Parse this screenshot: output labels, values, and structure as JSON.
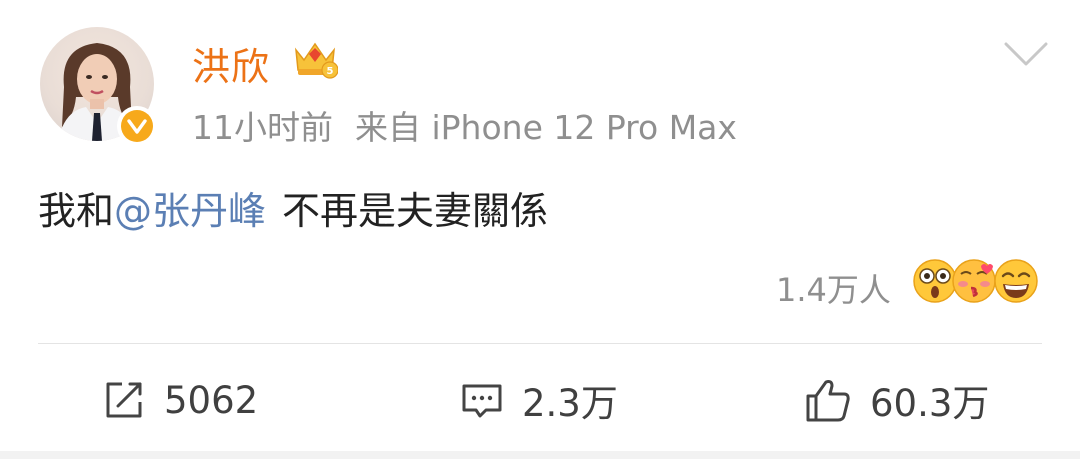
{
  "post": {
    "author": "洪欣",
    "time": "11小时前",
    "source": "来自 iPhone 12 Pro Max",
    "text_prefix": "我和",
    "mention": "@张丹峰",
    "text_suffix": "不再是夫妻關係"
  },
  "reactions": {
    "count_label": "1.4万人",
    "emoji_icons": [
      "shocked-emoji-icon",
      "kiss-emoji-icon",
      "laughing-emoji-icon"
    ]
  },
  "actions": {
    "repost": {
      "icon": "repost-icon",
      "count": "5062"
    },
    "comment": {
      "icon": "comment-icon",
      "count": "2.3万"
    },
    "like": {
      "icon": "thumbs-up-icon",
      "count": "60.3万"
    }
  },
  "colors": {
    "username": "#ec7216",
    "mention": "#5b7fb4",
    "verified_badge": "#f7a91b",
    "meta_text": "#8f8f8f"
  }
}
